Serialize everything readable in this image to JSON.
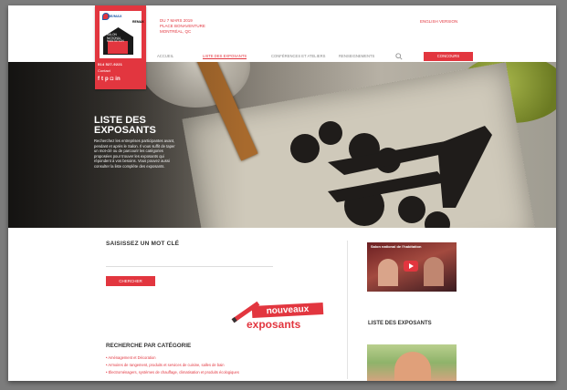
{
  "logo": {
    "brand_small": "RE/MAX",
    "brand_right": "REMAX",
    "tagline_lines": [
      "SALON",
      "NATIONAL",
      "HABITATION"
    ],
    "phone": "514 527-9221",
    "contact": "Contact",
    "social": [
      {
        "icon": "facebook-icon",
        "glyph": "f"
      },
      {
        "icon": "twitter-icon",
        "glyph": "t"
      },
      {
        "icon": "pinterest-icon",
        "glyph": "p"
      },
      {
        "icon": "instagram-icon",
        "glyph": "◘"
      },
      {
        "icon": "linkedin-icon",
        "glyph": "in"
      }
    ]
  },
  "header": {
    "address_lines": [
      "DU 7 MARS 2019",
      "PLACE BONAVENTURE",
      "MONTRÉAL, QC"
    ],
    "lang_link": "ENGLISH VERSION"
  },
  "nav": {
    "items": [
      {
        "label": "ACCUEIL",
        "active": false
      },
      {
        "label": "LISTE DES EXPOSANTS",
        "active": true
      },
      {
        "label": "CONFÉRENCES ET ATELIERS",
        "active": false
      },
      {
        "label": "RENSEIGNEMENTS",
        "active": false
      }
    ],
    "cta": "CONCOURS"
  },
  "hero": {
    "title": "LISTE DES EXPOSANTS",
    "description": "Recherchez les entreprises participantes avant, pendant et après le Salon. Il vous suffit de taper un mot-clé ou de parcourir les catégories proposées pour trouver les exposants qui répondent à vos besoins. Vous pouvez aussi consulter la liste complète des exposants."
  },
  "main": {
    "search_heading": "SAISISSEZ UN MOT CLÉ",
    "search_placeholder": "",
    "search_button": "CHERCHER",
    "badge_top": "nouveaux",
    "badge_bottom": "exposants",
    "category_heading": "RECHERCHE PAR CATÉGORIE",
    "categories": [
      "Aménagement et Décoration",
      "Armoires de rangement, produits et services de cuisine, salles de bain",
      "Électroménagers, systèmes de chauffage, climatisation et produits écologiques"
    ]
  },
  "sidebar": {
    "video_title": "Salon national de l'habitation",
    "list_heading": "LISTE DES EXPOSANTS"
  },
  "colors": {
    "accent": "#e2363f",
    "text_dark": "#333333"
  }
}
